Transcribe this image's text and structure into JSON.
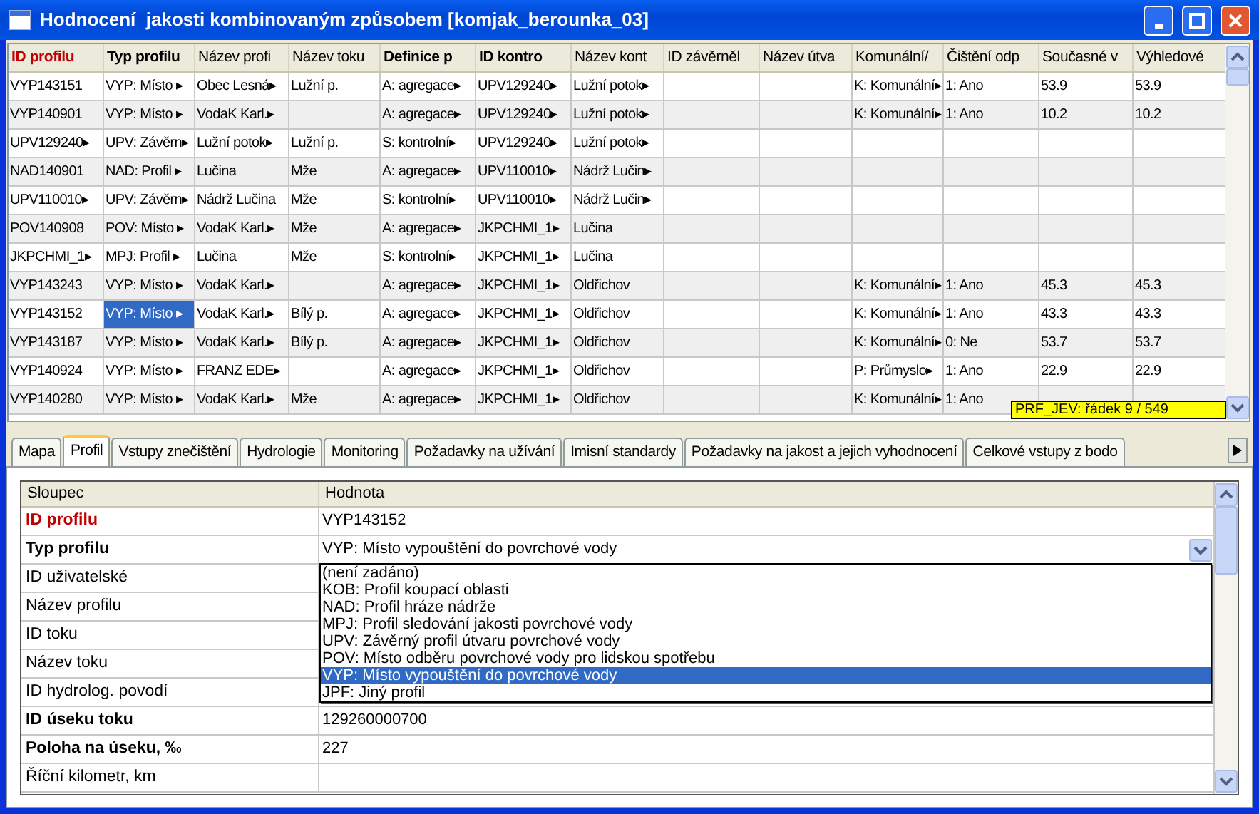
{
  "window": {
    "title": "Hodnocení  jakosti kombinovaným způsobem [komjak_berounka_03]"
  },
  "table": {
    "columns": [
      {
        "label": "ID profilu",
        "kind": "key"
      },
      {
        "label": "Typ profilu",
        "kind": "bold"
      },
      {
        "label": "Název profi",
        "kind": "plain"
      },
      {
        "label": "Název toku",
        "kind": "plain"
      },
      {
        "label": "Definice p",
        "kind": "bold"
      },
      {
        "label": "ID kontro",
        "kind": "bold"
      },
      {
        "label": "Název kont",
        "kind": "plain"
      },
      {
        "label": "ID závěrněl",
        "kind": "plain"
      },
      {
        "label": "Název útva",
        "kind": "plain"
      },
      {
        "label": "Komunální/",
        "kind": "plain"
      },
      {
        "label": "Čištění odp",
        "kind": "plain"
      },
      {
        "label": "Současné v",
        "kind": "plain"
      },
      {
        "label": "Výhledové",
        "kind": "plain"
      }
    ],
    "rows": [
      {
        "selected": false,
        "cells": [
          "VYP143151",
          "VYP: Místo ▸",
          "Obec Lesná▸",
          "Lužní p.",
          "A: agregace▸",
          "UPV129240▸",
          "Lužní potok▸",
          "",
          "",
          "K: Komunální▸",
          "1: Ano",
          "53.9",
          "53.9"
        ]
      },
      {
        "selected": false,
        "cells": [
          "VYP140901",
          "VYP: Místo ▸",
          "VodaK Karl.▸",
          "",
          "A: agregace▸",
          "UPV129240▸",
          "Lužní potok▸",
          "",
          "",
          "K: Komunální▸",
          "1: Ano",
          "10.2",
          "10.2"
        ]
      },
      {
        "selected": false,
        "cells": [
          "UPV129240▸",
          "UPV: Závěrn▸",
          "Lužní potok▸",
          "Lužní p.",
          "S: kontrolní▸",
          "UPV129240▸",
          "Lužní potok▸",
          "",
          "",
          "",
          "",
          "",
          ""
        ]
      },
      {
        "selected": false,
        "cells": [
          "NAD140901",
          "NAD: Profil ▸",
          "Lučina",
          "Mže",
          "A: agregace▸",
          "UPV110010▸",
          "Nádrž Lučin▸",
          "",
          "",
          "",
          "",
          "",
          ""
        ]
      },
      {
        "selected": false,
        "cells": [
          "UPV110010▸",
          "UPV: Závěrn▸",
          "Nádrž Lučina",
          "Mže",
          "S: kontrolní▸",
          "UPV110010▸",
          "Nádrž Lučin▸",
          "",
          "",
          "",
          "",
          "",
          ""
        ]
      },
      {
        "selected": false,
        "cells": [
          "POV140908",
          "POV: Místo ▸",
          "VodaK Karl.▸",
          "Mže",
          "A: agregace▸",
          "JKPCHMI_1▸",
          "Lučina",
          "",
          "",
          "",
          "",
          "",
          ""
        ]
      },
      {
        "selected": false,
        "cells": [
          "JKPCHMI_1▸",
          "MPJ: Profil ▸",
          "Lučina",
          "Mže",
          "S: kontrolní▸",
          "JKPCHMI_1▸",
          "Lučina",
          "",
          "",
          "",
          "",
          "",
          ""
        ]
      },
      {
        "selected": false,
        "cells": [
          "VYP143243",
          "VYP: Místo ▸",
          "VodaK Karl.▸",
          "",
          "A: agregace▸",
          "JKPCHMI_1▸",
          "Oldřichov",
          "",
          "",
          "K: Komunální▸",
          "1: Ano",
          "45.3",
          "45.3"
        ]
      },
      {
        "selected": true,
        "cells": [
          "VYP143152",
          "VYP: Místo ▸",
          "VodaK Karl.▸",
          "Bílý p.",
          "A: agregace▸",
          "JKPCHMI_1▸",
          "Oldřichov",
          "",
          "",
          "K: Komunální▸",
          "1: Ano",
          "43.3",
          "43.3"
        ]
      },
      {
        "selected": false,
        "cells": [
          "VYP143187",
          "VYP: Místo ▸",
          "VodaK Karl.▸",
          "Bílý p.",
          "A: agregace▸",
          "JKPCHMI_1▸",
          "Oldřichov",
          "",
          "",
          "K: Komunální▸",
          "0: Ne",
          "53.7",
          "53.7"
        ]
      },
      {
        "selected": false,
        "cells": [
          "VYP140924",
          "VYP: Místo ▸",
          "FRANZ EDE▸",
          "",
          "A: agregace▸",
          "JKPCHMI_1▸",
          "Oldřichov",
          "",
          "",
          "P: Průmyslo▸",
          "1: Ano",
          "22.9",
          "22.9"
        ]
      },
      {
        "selected": false,
        "cells": [
          "VYP140280",
          "VYP: Místo ▸",
          "VodaK Karl.▸",
          "Mže",
          "A: agregace▸",
          "JKPCHMI_1▸",
          "Oldřichov",
          "",
          "",
          "K: Komunální▸",
          "1: Ano",
          "",
          ""
        ]
      }
    ],
    "tooltip": "PRF_JEV: řádek 9 / 549"
  },
  "tabs": [
    {
      "label": "Mapa",
      "selected": false
    },
    {
      "label": "Profil",
      "selected": true
    },
    {
      "label": "Vstupy znečištění",
      "selected": false
    },
    {
      "label": "Hydrologie",
      "selected": false
    },
    {
      "label": "Monitoring",
      "selected": false
    },
    {
      "label": "Požadavky na užívání",
      "selected": false
    },
    {
      "label": "Imisní standardy",
      "selected": false
    },
    {
      "label": "Požadavky na jakost a jejich vyhodnocení",
      "selected": false
    },
    {
      "label": "Celkové vstupy z bodo",
      "selected": false
    }
  ],
  "properties": {
    "columns": [
      "Sloupec",
      "Hodnota"
    ],
    "rows": [
      {
        "label": "ID profilu",
        "kind": "key",
        "value": "VYP143152"
      },
      {
        "label": "Typ profilu",
        "kind": "bold",
        "value": "VYP: Místo vypouštění do povrchové vody",
        "expanded": true,
        "options": [
          {
            "label": "(není zadáno)",
            "selected": false
          },
          {
            "label": "KOB: Profil koupací oblasti",
            "selected": false
          },
          {
            "label": "NAD: Profil hráze nádrže",
            "selected": false
          },
          {
            "label": "MPJ: Profil sledování jakosti povrchové vody",
            "selected": false
          },
          {
            "label": "UPV: Závěrný profil útvaru povrchové vody",
            "selected": false
          },
          {
            "label": "POV: Místo odběru povrchové vody pro lidskou spotřebu",
            "selected": false
          },
          {
            "label": "VYP: Místo vypouštění do povrchové vody",
            "selected": true
          },
          {
            "label": "JPF: Jiný profil",
            "selected": false
          }
        ]
      },
      {
        "label": "ID uživatelské",
        "kind": "plain"
      },
      {
        "label": "Název profilu",
        "kind": "plain"
      },
      {
        "label": "ID toku",
        "kind": "plain"
      },
      {
        "label": "Název toku",
        "kind": "plain"
      },
      {
        "label": "ID hydrolog. povodí",
        "kind": "plain"
      },
      {
        "label": "ID úseku toku",
        "kind": "bold",
        "value": "129260000700"
      },
      {
        "label": "Poloha na úseku, ‰",
        "kind": "bold",
        "value": "227"
      },
      {
        "label": "Říční kilometr, km",
        "kind": "plain"
      }
    ]
  }
}
